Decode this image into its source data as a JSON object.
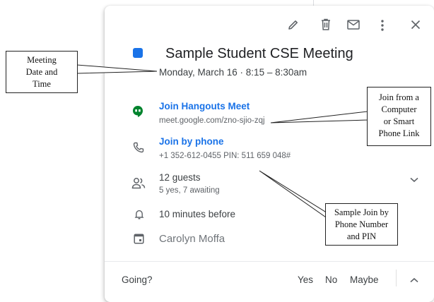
{
  "event": {
    "color": "#1a73e8",
    "title": "Sample Student CSE Meeting",
    "datetime": "Monday, March 16  ·  8:15 – 8:30am"
  },
  "toolbar": {
    "edit_icon": "pencil-icon",
    "delete_icon": "trash-icon",
    "email_icon": "mail-icon",
    "more_icon": "more-vert-icon",
    "close_icon": "close-icon"
  },
  "hangouts": {
    "label": "Join Hangouts Meet",
    "url": "meet.google.com/zno-sjio-zqj",
    "icon": "hangouts-meet-icon",
    "color": "#00832d"
  },
  "phone": {
    "label": "Join by phone",
    "details": "+1 352-612-0455 PIN: 511 659 048#",
    "icon": "phone-icon"
  },
  "guests": {
    "count": "12 guests",
    "summary": "5 yes, 7 awaiting",
    "icon": "people-icon"
  },
  "reminder": {
    "text": "10 minutes before",
    "icon": "bell-icon"
  },
  "calendar": {
    "owner": "Carolyn Moffa",
    "icon": "calendar-icon"
  },
  "rsvp": {
    "prompt": "Going?",
    "yes": "Yes",
    "no": "No",
    "maybe": "Maybe"
  },
  "annotations": {
    "datetime_callout": [
      "Meeting",
      "Date and",
      "Time"
    ],
    "link_callout": [
      "Join from a",
      "Computer",
      "or Smart",
      "Phone Link"
    ],
    "phone_callout": [
      "Sample Join by",
      "Phone Number",
      "and PIN"
    ]
  }
}
